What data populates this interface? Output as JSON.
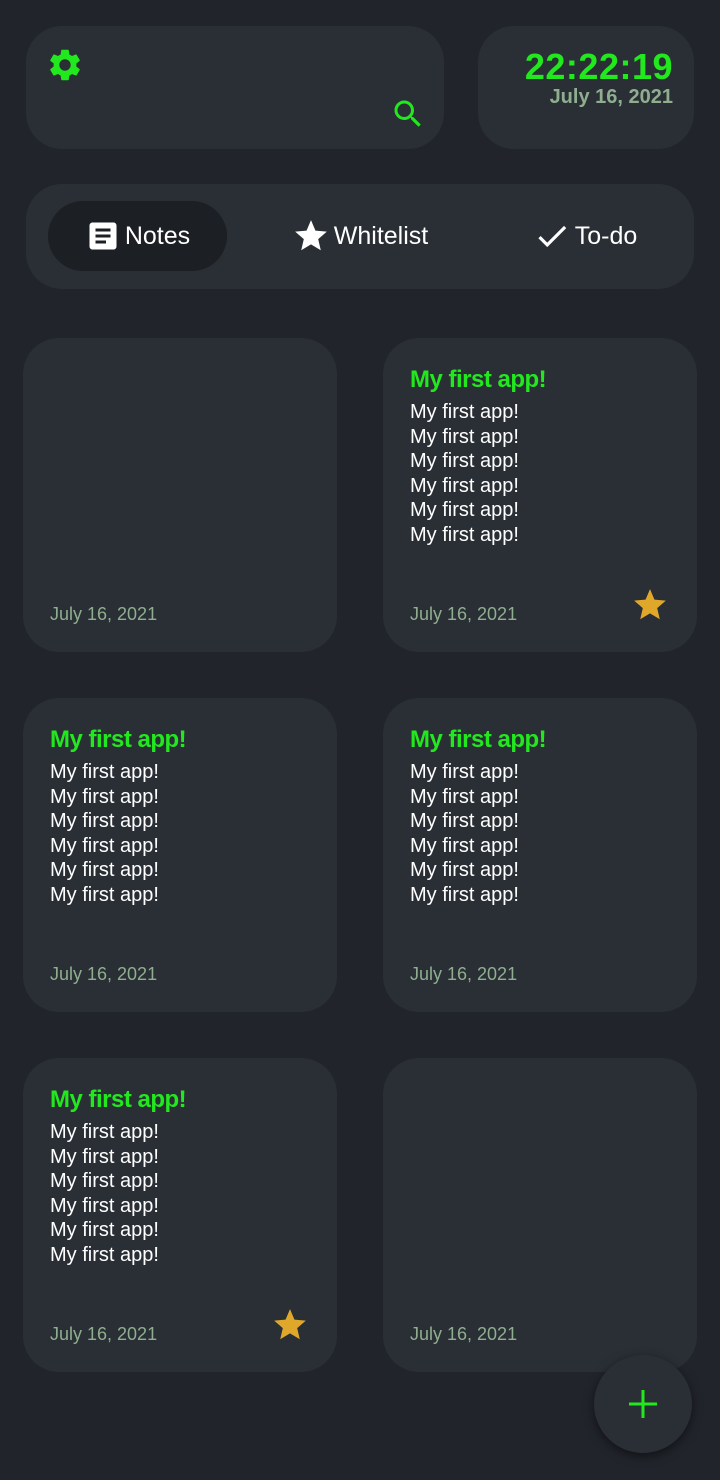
{
  "header": {
    "settings_icon": "gear-icon",
    "search_icon": "search-icon",
    "clock": {
      "time": "22:22:19",
      "date": "July 16, 2021"
    }
  },
  "tabs": [
    {
      "label": "Notes",
      "icon": "note-icon",
      "active": true
    },
    {
      "label": "Whitelist",
      "icon": "star-icon",
      "active": false
    },
    {
      "label": "To-do",
      "icon": "check-icon",
      "active": false
    }
  ],
  "notes": [
    {
      "title": "",
      "lines": [],
      "date": "July 16, 2021",
      "starred": false
    },
    {
      "title": "My first app!",
      "lines": [
        "My first app!",
        "My first app!",
        "My first app!",
        "My first app!",
        "My first app!",
        "My first app!"
      ],
      "date": "July 16, 2021",
      "starred": true
    },
    {
      "title": "My first app!",
      "lines": [
        "My first app!",
        "My first app!",
        "My first app!",
        "My first app!",
        "My first app!",
        "My first app!"
      ],
      "date": "July 16, 2021",
      "starred": false
    },
    {
      "title": "My first app!",
      "lines": [
        "My first app!",
        "My first app!",
        "My first app!",
        "My first app!",
        "My first app!",
        "My first app!"
      ],
      "date": "July 16, 2021",
      "starred": false
    },
    {
      "title": "My first app!",
      "lines": [
        "My first app!",
        "My first app!",
        "My first app!",
        "My first app!",
        "My first app!",
        "My first app!"
      ],
      "date": "July 16, 2021",
      "starred": true
    },
    {
      "title": "",
      "lines": [],
      "date": "July 16, 2021",
      "starred": false
    }
  ],
  "fab": {
    "icon": "plus-icon"
  },
  "colors": {
    "background": "#21242b",
    "surface": "#2a2f36",
    "accent": "#22e81e",
    "muted": "#8fae8f",
    "star": "#e0a82a"
  }
}
